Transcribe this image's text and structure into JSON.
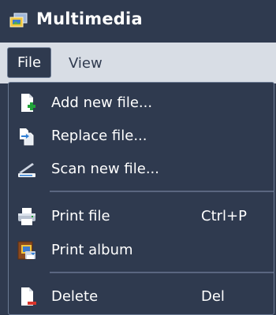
{
  "window": {
    "title": "Multimedia",
    "icon": "multimedia-app-icon"
  },
  "menubar": {
    "items": [
      {
        "label": "File",
        "active": true
      },
      {
        "label": "View",
        "active": false
      }
    ]
  },
  "file_menu": {
    "items": [
      {
        "label": "Add new file...",
        "icon": "add-file-icon"
      },
      {
        "label": "Replace file...",
        "icon": "replace-file-icon"
      },
      {
        "label": "Scan new file...",
        "icon": "scanner-icon"
      },
      {
        "label": "Print file",
        "shortcut": "Ctrl+P",
        "icon": "printer-icon"
      },
      {
        "label": "Print album",
        "icon": "print-album-icon"
      },
      {
        "label": "Delete",
        "shortcut": "Del",
        "icon": "delete-file-icon"
      }
    ]
  },
  "colors": {
    "titlebar": "#2f3a4f",
    "menubar": "#d8dde5",
    "accent_green": "#22a33a",
    "accent_red": "#d9342b"
  }
}
